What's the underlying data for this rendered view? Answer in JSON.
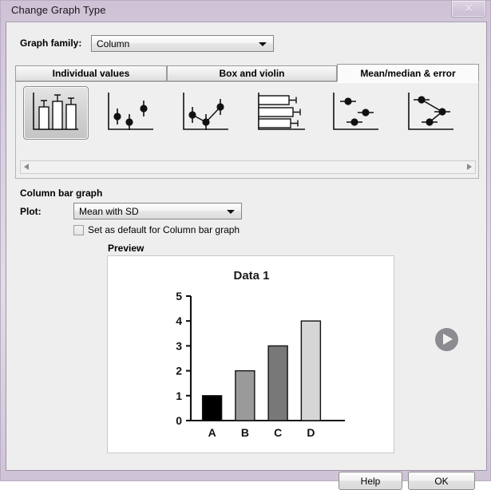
{
  "window": {
    "title": "Change Graph Type",
    "close_icon": "close-icon",
    "close_glyph": "✕"
  },
  "graph_family": {
    "label": "Graph family:",
    "value": "Column",
    "dropdown_icon": "chevron-down-icon"
  },
  "tabs": [
    {
      "label": "Individual values",
      "selected": false
    },
    {
      "label": "Box and violin",
      "selected": false
    },
    {
      "label": "Mean/median & error",
      "selected": true
    }
  ],
  "gallery": {
    "items": [
      {
        "name": "column-bar-graph-with-error-bars",
        "selected": true
      },
      {
        "name": "scatter-with-vertical-error-bars",
        "selected": false
      },
      {
        "name": "line-connecting-means-with-error-bars",
        "selected": false
      },
      {
        "name": "horizontal-bar-graph-with-error-bars",
        "selected": false
      },
      {
        "name": "scatter-with-horizontal-error-bars",
        "selected": false
      },
      {
        "name": "horizontal-line-connecting-means",
        "selected": false
      }
    ],
    "scroll_left_icon": "triangle-left-icon",
    "scroll_right_icon": "triangle-right-icon"
  },
  "options": {
    "section_title": "Column bar graph",
    "plot_label": "Plot:",
    "plot_value": "Mean with SD",
    "plot_dropdown_icon": "chevron-down-icon",
    "set_default_label": "Set as default for Column bar graph",
    "set_default_checked": false
  },
  "preview": {
    "label": "Preview",
    "play_icon": "play-circle-icon"
  },
  "buttons": {
    "help": "Help",
    "ok": "OK"
  },
  "chart_data": {
    "type": "bar",
    "title": "Data 1",
    "categories": [
      "A",
      "B",
      "C",
      "D"
    ],
    "values": [
      1,
      2,
      3,
      4
    ],
    "colors": [
      "#000000",
      "#9a9a9a",
      "#787878",
      "#d6d6d6"
    ],
    "xlabel": "",
    "ylabel": "",
    "ylim": [
      0,
      5
    ],
    "yticks": [
      0,
      1,
      2,
      3,
      4,
      5
    ],
    "grid": false,
    "legend": false
  }
}
